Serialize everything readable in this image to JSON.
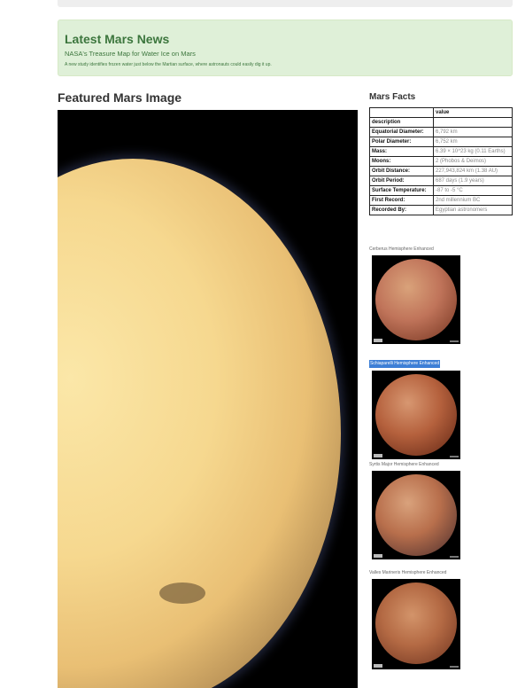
{
  "news": {
    "heading": "Latest Mars News",
    "title": "NASA's Treasure Map for Water Ice on Mars",
    "teaser": "A new study identifies frozen water just below the Martian surface, where astronauts could easily dig it up."
  },
  "featured": {
    "heading": "Featured Mars Image"
  },
  "facts": {
    "heading": "Mars Facts",
    "column_header": "value",
    "index_header": "description",
    "rows": [
      {
        "label": "Equatorial Diameter:",
        "value": "6,792 km"
      },
      {
        "label": "Polar Diameter:",
        "value": "6,752 km"
      },
      {
        "label": "Mass:",
        "value": "6.39 × 10^23 kg (0.11 Earths)"
      },
      {
        "label": "Moons:",
        "value": "2 (Phobos & Deimos)"
      },
      {
        "label": "Orbit Distance:",
        "value": "227,943,824 km (1.38 AU)"
      },
      {
        "label": "Orbit Period:",
        "value": "687 days (1.9 years)"
      },
      {
        "label": "Surface Temperature:",
        "value": "-87 to -5 °C"
      },
      {
        "label": "First Record:",
        "value": "2nd millennium BC"
      },
      {
        "label": "Recorded By:",
        "value": "Egyptian astronomers"
      }
    ]
  },
  "hemispheres": [
    {
      "title": "Cerberus Hemisphere Enhanced"
    },
    {
      "title": "Schiaparelli Hemisphere Enhanced"
    },
    {
      "title": "Syrtis Major Hemisphere Enhanced"
    },
    {
      "title": "Valles Marineris Hemisphere Enhanced"
    }
  ]
}
